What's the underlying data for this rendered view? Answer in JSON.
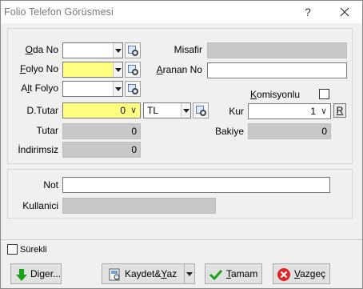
{
  "window": {
    "title": "Folio Telefon Görüsmesi",
    "help_glyph": "?",
    "close_glyph": "✕"
  },
  "form": {
    "oda_no": {
      "label": "Oda No",
      "value": ""
    },
    "folyo_no": {
      "label": "Folyo No",
      "value": ""
    },
    "alt_folyo": {
      "label": "Alt Folyo",
      "value": ""
    },
    "d_tutar": {
      "label": "D.Tutar",
      "value": "0"
    },
    "currency": {
      "value": "TL"
    },
    "tutar": {
      "label": "Tutar",
      "value": "0"
    },
    "indirimsiz": {
      "label": "İndirimsiz",
      "value": "0"
    },
    "misafir": {
      "label": "Misafir",
      "value": ""
    },
    "aranan_no": {
      "label": "Aranan No",
      "value": ""
    },
    "komisyonlu": {
      "label": "Komisyonlu",
      "checked": false
    },
    "kur": {
      "label": "Kur",
      "value": "1",
      "r_button": "R"
    },
    "bakiye": {
      "label": "Bakiye",
      "value": "0"
    },
    "not": {
      "label": "Not",
      "value": ""
    },
    "kullanici": {
      "label": "Kullanici",
      "value": ""
    }
  },
  "footer": {
    "surekli": {
      "label": "Sürekli",
      "checked": false
    },
    "buttons": {
      "diger": "Diger...",
      "kaydet": "Kaydet&Yaz",
      "tamam": "Tamam",
      "vazgec": "Vazgeç"
    }
  },
  "colors": {
    "required_field": "#ffff80",
    "readonly_field": "#c8c8c8"
  }
}
